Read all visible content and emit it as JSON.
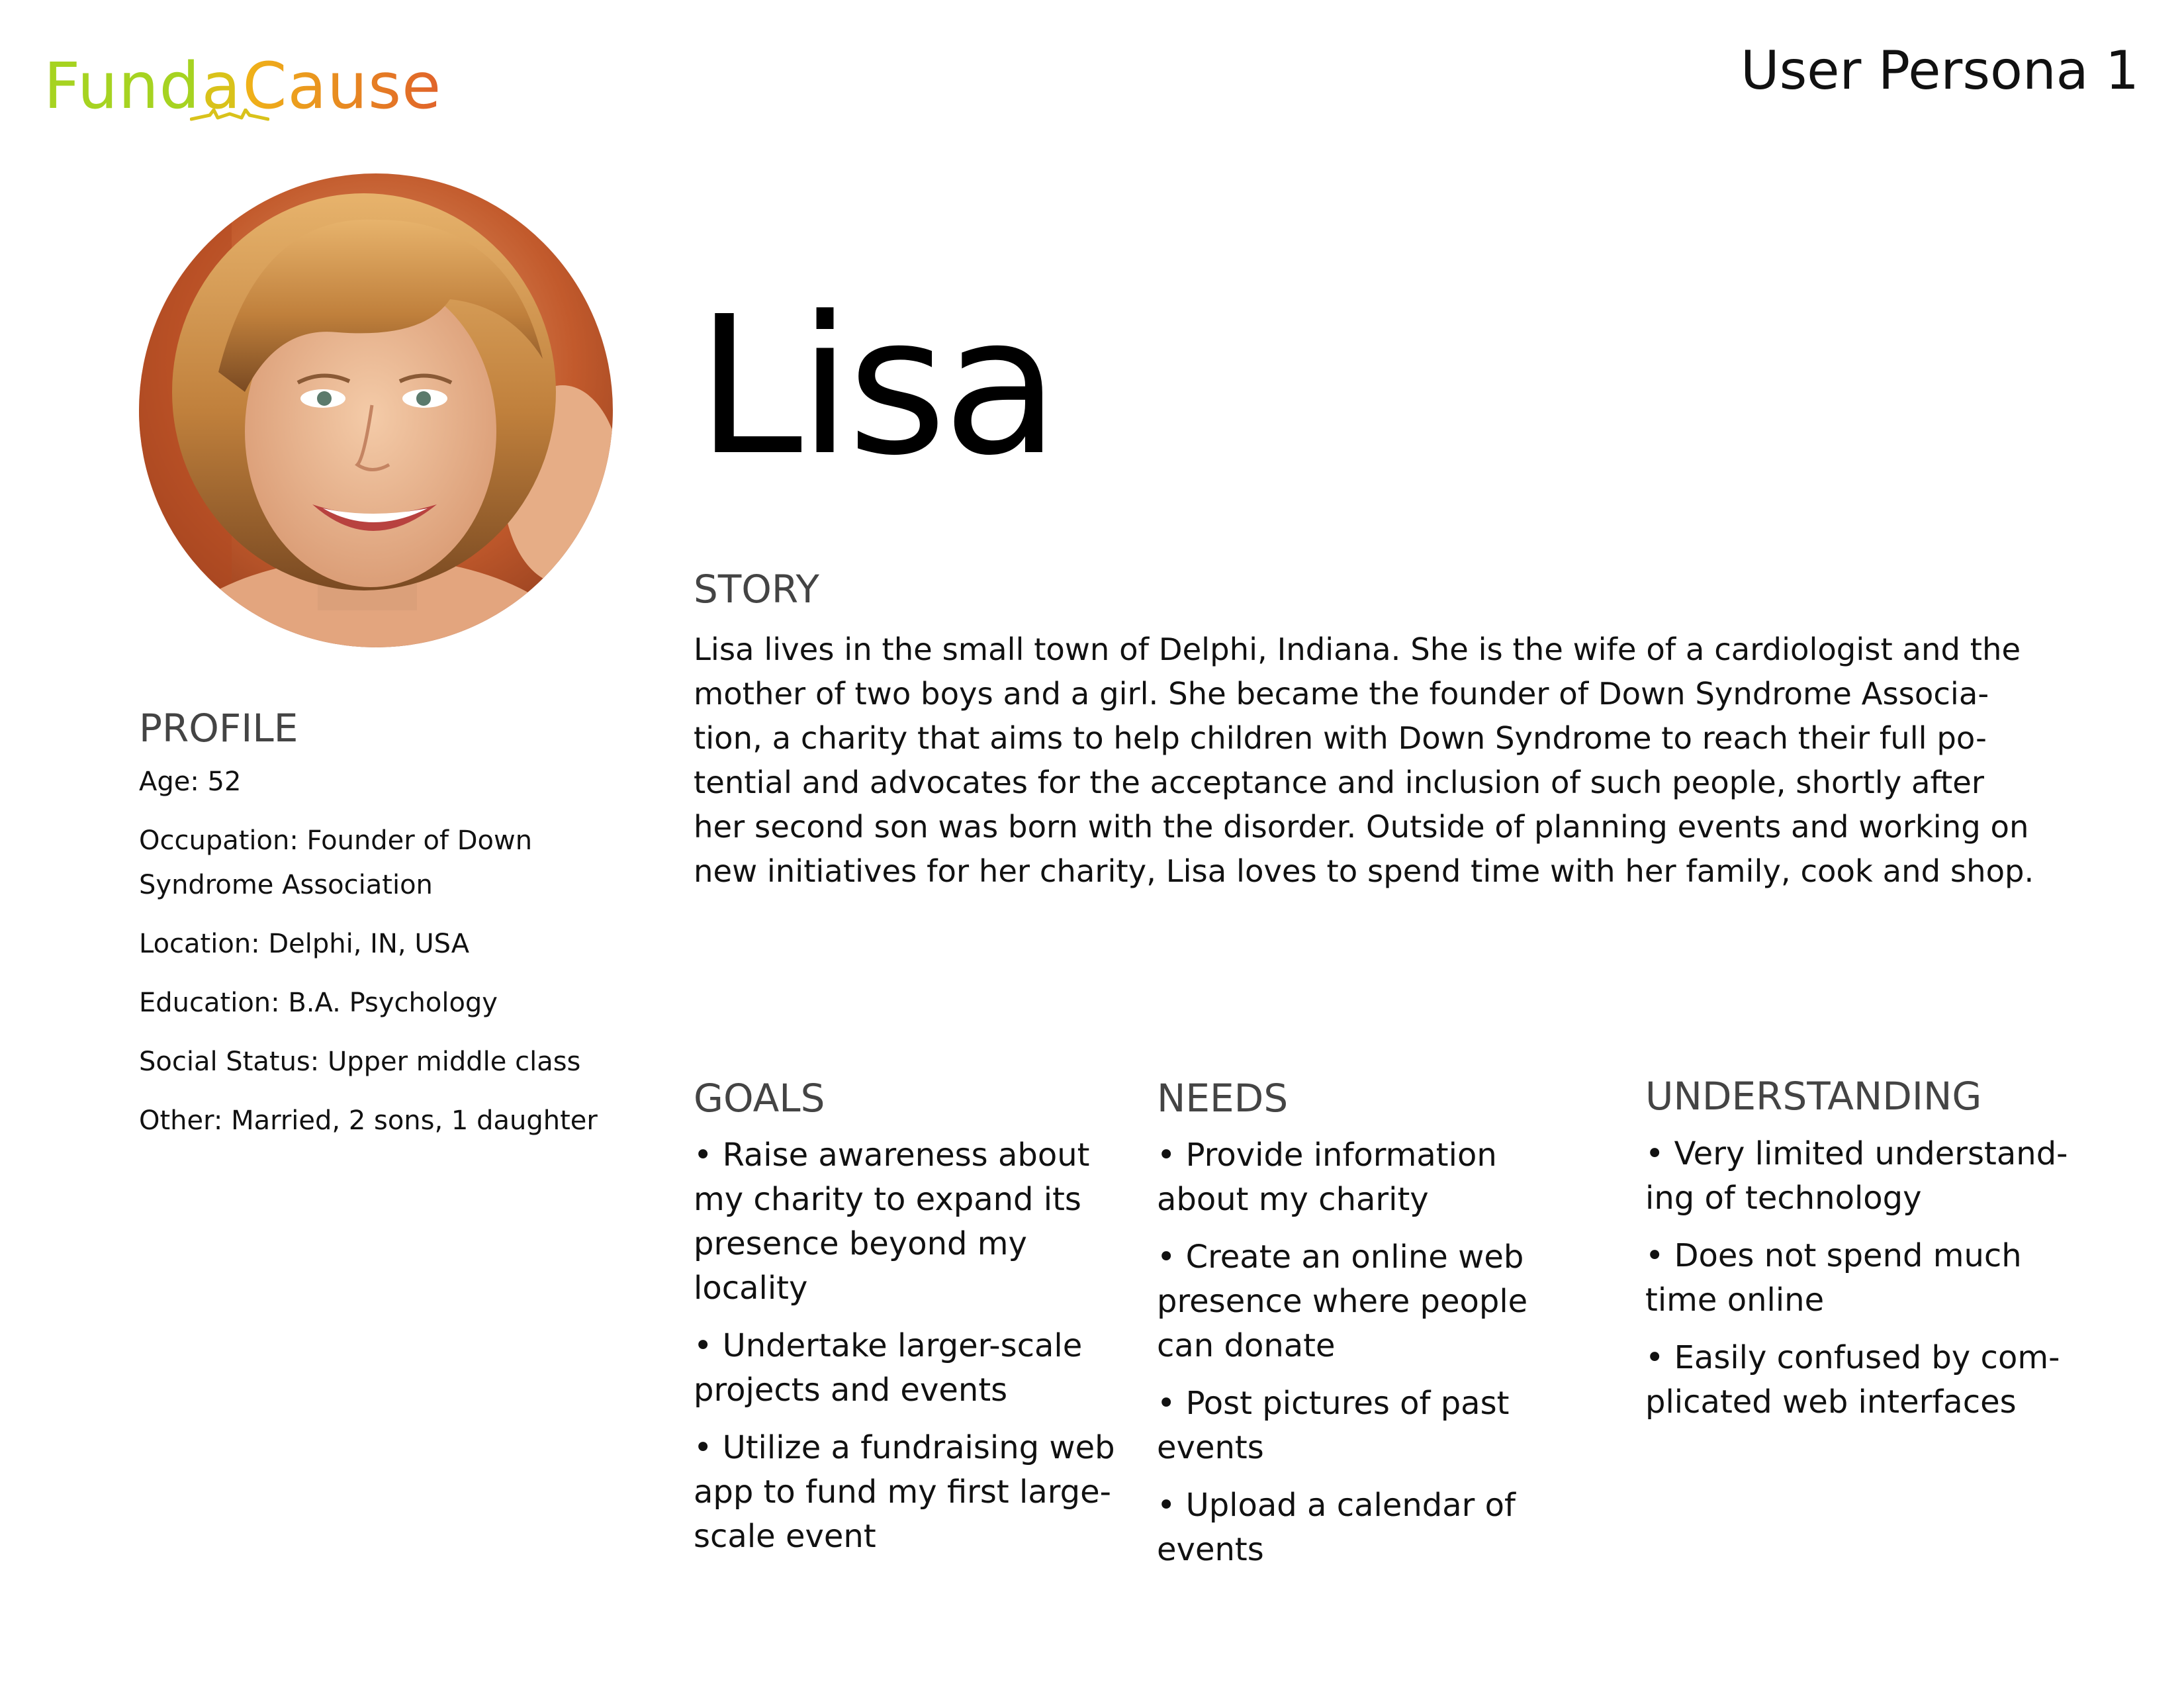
{
  "logo": {
    "word1": "Fund",
    "word2": "a",
    "word3": "Cause",
    "colors": {
      "fund": "#a6d321",
      "a": "#d9c21a",
      "cause_start": "#f0b418",
      "cause_end": "#e0622a"
    }
  },
  "header": {
    "persona_title": "User Persona 1"
  },
  "persona": {
    "name": "Lisa"
  },
  "story": {
    "heading": "STORY",
    "lines": [
      "Lisa lives in the small town of Delphi, Indiana. She is the wife of a cardiologist and the",
      "mother of two boys and a girl. She became the founder of Down Syndrome Associa-",
      "tion, a charity that aims to help children with Down Syndrome to reach their full po-",
      "tential and advocates for the acceptance and inclusion of such people, shortly after",
      "her second son was born with the disorder. Outside of planning events and working on",
      "new initiatives for her charity, Lisa loves to spend time with her family, cook and shop."
    ]
  },
  "profile": {
    "heading": "PROFILE",
    "items": [
      "Age: 52",
      "Occupation: Founder of Down Syndrome Association",
      "Location: Delphi, IN, USA",
      "Education: B.A. Psychology",
      "Social Status: Upper middle class",
      "Other: Married, 2 sons, 1 daughter"
    ]
  },
  "goals": {
    "heading": "GOALS",
    "items": [
      "• Raise awareness about my charity to expand its presence beyond my locality",
      "• Undertake larger-scale projects and events",
      "• Utilize a fundraising web app to fund my first large-scale event"
    ]
  },
  "needs": {
    "heading": "NEEDS",
    "items": [
      "• Provide information about my charity",
      "• Create an online web presence where people can donate",
      "• Post pictures of past events",
      "• Upload a calendar of events"
    ]
  },
  "understanding": {
    "heading": "UNDERSTANDING",
    "items": [
      "• Very limited understand-ing of technology",
      "• Does not spend much time online",
      "• Easily confused by com-plicated web interfaces"
    ]
  }
}
